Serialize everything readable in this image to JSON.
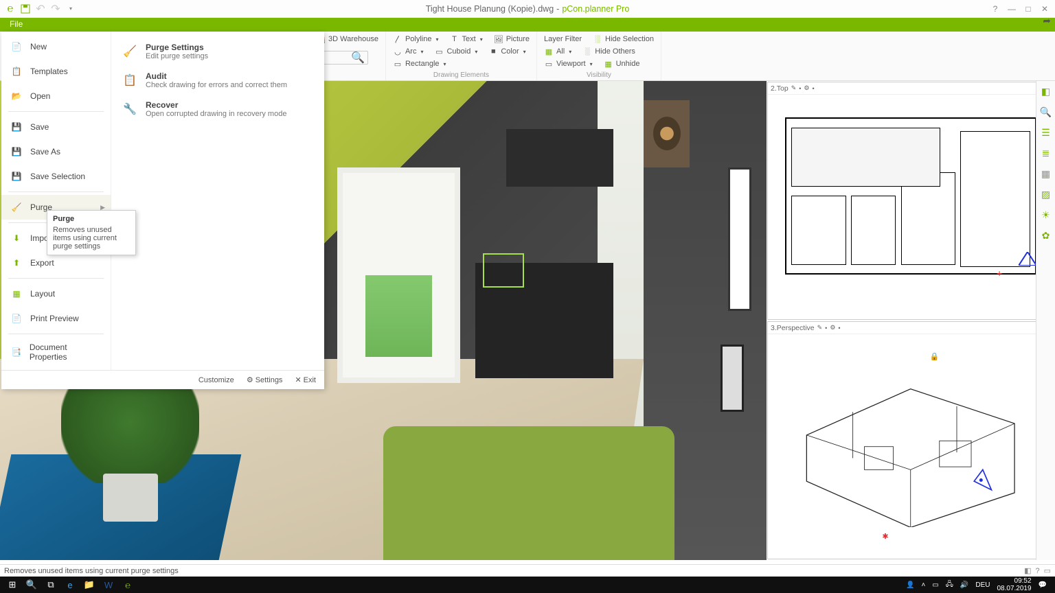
{
  "titlebar": {
    "filename": "Tight House Planung (Kopie).dwg",
    "separator": " - ",
    "appname": "pCon.planner Pro"
  },
  "file_tab": {
    "label": "File"
  },
  "file_menu": {
    "items": [
      {
        "label": "New"
      },
      {
        "label": "Templates"
      },
      {
        "label": "Open"
      },
      {
        "label": "Save"
      },
      {
        "label": "Save As"
      },
      {
        "label": "Save Selection"
      },
      {
        "label": "Purge",
        "has_sub": true,
        "active": true
      },
      {
        "label": "Import"
      },
      {
        "label": "Export"
      },
      {
        "label": "Layout"
      },
      {
        "label": "Print Preview"
      },
      {
        "label": "Document Properties"
      }
    ],
    "sub": [
      {
        "title": "Purge Settings",
        "desc": "Edit purge settings"
      },
      {
        "title": "Audit",
        "desc": "Check drawing for errors and correct them"
      },
      {
        "title": "Recover",
        "desc": "Open corrupted drawing in recovery mode"
      }
    ],
    "footer": {
      "customize": "Customize",
      "settings": "Settings",
      "exit": "Exit"
    }
  },
  "tooltip": {
    "title": "Purge",
    "desc": "Removes unused items using current purge settings"
  },
  "ribbon": {
    "group1": {
      "warehouse": "3D Warehouse"
    },
    "group2": {
      "polyline": "Polyline",
      "arc": "Arc",
      "rectangle": "Rectangle",
      "text": "Text",
      "cuboid": "Cuboid",
      "picture": "Picture",
      "color": "Color",
      "label": "Drawing Elements"
    },
    "group3": {
      "layerfilter": "Layer Filter",
      "all": "All",
      "viewport": "Viewport",
      "hidesel": "Hide Selection",
      "hideoth": "Hide Others",
      "unhide": "Unhide",
      "label": "Visibility"
    }
  },
  "viewports": {
    "top": {
      "label": "2.Top"
    },
    "persp": {
      "label": "3.Perspective"
    }
  },
  "statusbar": {
    "text": "Removes unused items using current purge settings"
  },
  "taskbar": {
    "lang": "DEU",
    "time": "09:52",
    "date": "08.07.2019"
  }
}
